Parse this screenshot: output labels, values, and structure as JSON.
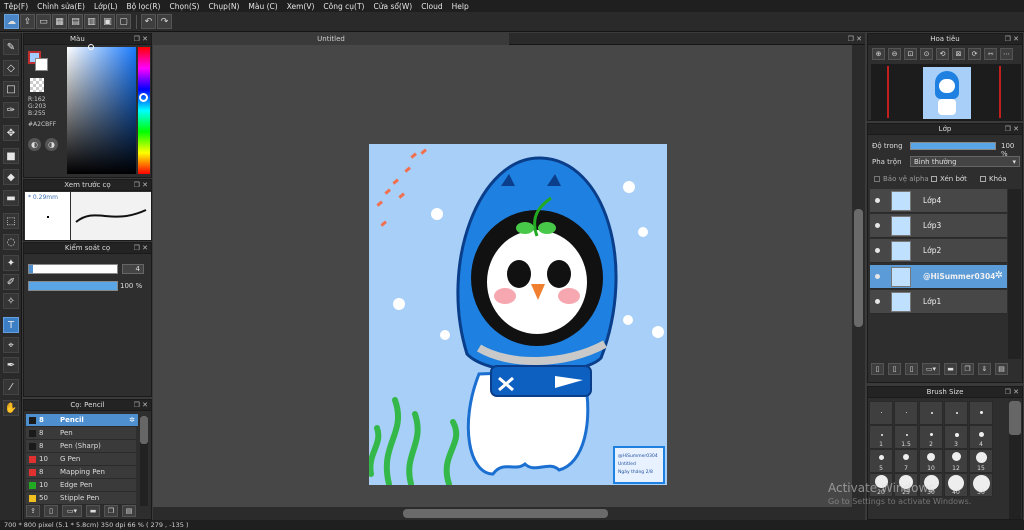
{
  "menu": [
    "Tệp(F)",
    "Chỉnh sửa(E)",
    "Lớp(L)",
    "Bộ lọc(R)",
    "Chọn(S)",
    "Chụp(N)",
    "Màu (C)",
    "Xem(V)",
    "Công cụ(T)",
    "Cửa sổ(W)",
    "Cloud",
    "Help"
  ],
  "color_panel": {
    "title": "Màu",
    "r": "R:162",
    "g": "G:203",
    "b": "B:255",
    "hex": "#A2CBFF"
  },
  "brush_preview": {
    "title": "Xem trước cọ",
    "size": "0.29mm"
  },
  "brush_control": {
    "title": "Kiểm soát cọ",
    "size_value": "4",
    "opacity_value": "100 %"
  },
  "brush_list": {
    "title": "Cọ: Pencil",
    "items": [
      {
        "size": "8",
        "name": "Pencil",
        "color": "#1a1a1a"
      },
      {
        "size": "8",
        "name": "Pen",
        "color": "#1a1a1a"
      },
      {
        "size": "8",
        "name": "Pen (Sharp)",
        "color": "#1a1a1a"
      },
      {
        "size": "10",
        "name": "G Pen",
        "color": "#e03030"
      },
      {
        "size": "8",
        "name": "Mapping Pen",
        "color": "#e03030"
      },
      {
        "size": "10",
        "name": "Edge Pen",
        "color": "#22aa22"
      },
      {
        "size": "50",
        "name": "Stipple Pen",
        "color": "#f0c020"
      }
    ]
  },
  "canvas": {
    "tab_title": "Untitled"
  },
  "artwork": {
    "card_lines": [
      "@HiSummer0304",
      "Untitled",
      "Ngày tháng 2/8"
    ]
  },
  "navigator": {
    "title": "Hoa tiêu"
  },
  "layers": {
    "title": "Lớp",
    "opacity_label": "Độ trong",
    "opacity_value": "100 %",
    "blend_label": "Pha trộn",
    "blend_value": "Bình thường",
    "protect_alpha": "Bảo vệ alpha",
    "clipping": "Xén bớt",
    "lock": "Khóa",
    "items": [
      {
        "name": "Lớp4",
        "selected": false
      },
      {
        "name": "Lớp3",
        "selected": false
      },
      {
        "name": "Lớp2",
        "selected": false
      },
      {
        "name": "@HiSummer0304",
        "selected": true
      },
      {
        "name": "Lớp1",
        "selected": false
      }
    ]
  },
  "brush_size": {
    "title": "Brush Size",
    "row1": [
      "",
      "",
      "",
      "",
      ""
    ],
    "row2": [
      "1",
      "1.5",
      "2",
      "3",
      "4"
    ],
    "row3": [
      "5",
      "7",
      "10",
      "12",
      "15"
    ],
    "row4": [
      "20",
      "25",
      "30",
      "40",
      "50"
    ]
  },
  "status_bar": "700 * 800 pixel  (5.1 * 5.8cm)  350 dpi  66 %  ( 279 , -135 )",
  "watermark": {
    "line1": "Activate Windows",
    "line2": "Go to Settings to activate Windows."
  },
  "colors": {
    "accent": "#5b9bd8",
    "canvas_bg": "#a8cff8"
  }
}
